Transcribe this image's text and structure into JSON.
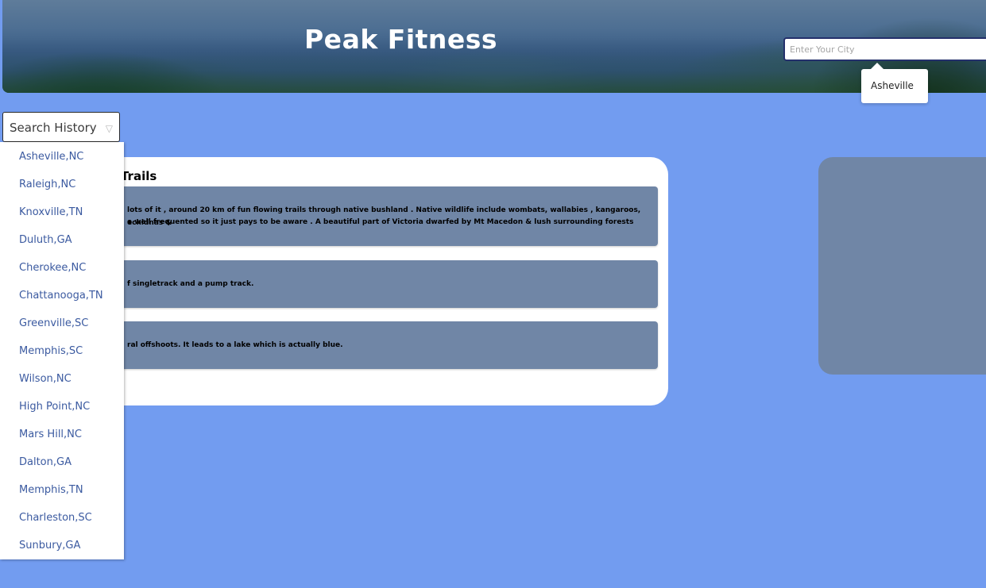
{
  "header": {
    "title": "Peak Fitness",
    "search_placeholder": "Enter Your City",
    "suggestion": "Asheville"
  },
  "history": {
    "label": "Search History",
    "caret": "▽",
    "items": [
      "Asheville,NC",
      "Raleigh,NC",
      "Knoxville,TN",
      "Duluth,GA",
      "Cherokee,NC",
      "Chattanooga,TN",
      "Greenville,SC",
      "Memphis,SC",
      "Wilson,NC",
      "High Point,NC",
      "Mars Hill,NC",
      "Dalton,GA",
      "Memphis,TN",
      "Charleston,SC",
      "Sunbury,GA"
    ]
  },
  "trails": {
    "title_fragment": "g Trails",
    "cards": [
      {
        "line1": "lots of it , around 20 km of fun flowing trails through native bushland . Native wildlife include wombats, wallabies , kangaroos, echidnas &",
        "line2": "e well frequented so it just pays to be aware . A beautiful part of Victoria dwarfed by Mt Macedon & lush surrounding forests"
      },
      {
        "line1": "f singletrack and a pump track."
      },
      {
        "line1": "ral offshoots. It leads to a lake which is actually blue."
      }
    ]
  }
}
